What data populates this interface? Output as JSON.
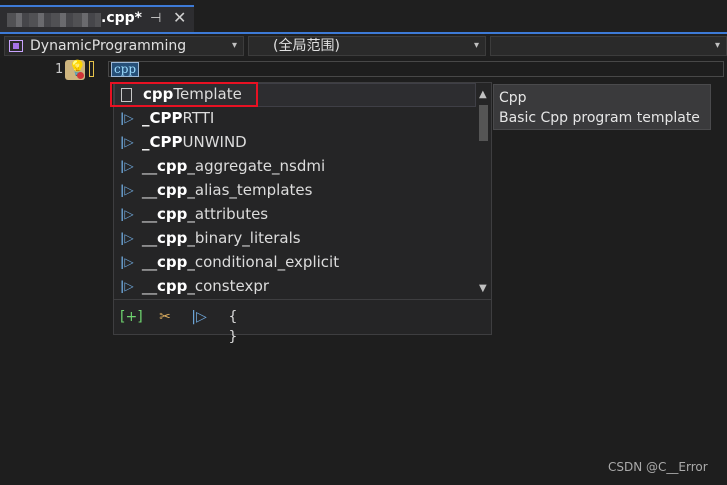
{
  "tab": {
    "title": ".cpp*",
    "pin_glyph": "⊣",
    "close_glyph": "✕"
  },
  "navbar": {
    "project": "DynamicProgramming",
    "scope": "(全局范围)",
    "caret": "▾"
  },
  "editor": {
    "line_number": "1",
    "typed_text": "cpp"
  },
  "completion": {
    "items": [
      {
        "bold": "cpp",
        "rest": "Template",
        "icon": "snippet-icon"
      },
      {
        "bold": "_CPP",
        "rest": "RTTI",
        "icon": "macro-icon",
        "lead": ""
      },
      {
        "bold": "_CPP",
        "rest": "UNWIND",
        "icon": "macro-icon"
      },
      {
        "lead": "__",
        "bold": "cpp",
        "rest": "_aggregate_nsdmi",
        "icon": "macro-icon"
      },
      {
        "lead": "__",
        "bold": "cpp",
        "rest": "_alias_templates",
        "icon": "macro-icon"
      },
      {
        "lead": "__",
        "bold": "cpp",
        "rest": "_attributes",
        "icon": "macro-icon"
      },
      {
        "lead": "__",
        "bold": "cpp",
        "rest": "_binary_literals",
        "icon": "macro-icon"
      },
      {
        "lead": "__",
        "bold": "cpp",
        "rest": "_conditional_explicit",
        "icon": "macro-icon"
      },
      {
        "lead": "__",
        "bold": "cpp",
        "rest": "_constexpr",
        "icon": "macro-icon"
      }
    ],
    "filters": {
      "expand": "[+]",
      "snippets": "✂",
      "macros": "|▷",
      "braces": "{ }"
    }
  },
  "tooltip": {
    "title": "Cpp",
    "description": "Basic Cpp program template"
  },
  "watermark": "CSDN @C__Error",
  "colors": {
    "accent": "#3d7ad6",
    "highlight": "#e81123",
    "macro": "#6fa8dc"
  }
}
